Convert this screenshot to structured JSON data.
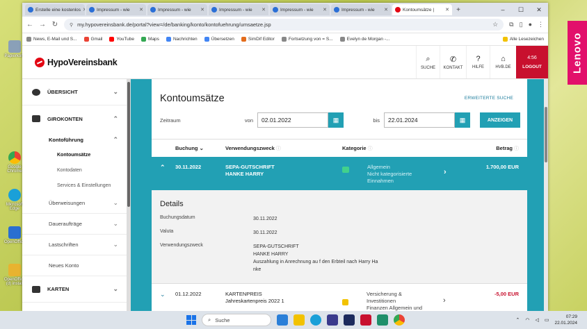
{
  "browser": {
    "tabs": [
      {
        "label": "Erstelle eine kostenlos",
        "active": false
      },
      {
        "label": "Impressum - wie",
        "active": false
      },
      {
        "label": "Impressum - wie",
        "active": false
      },
      {
        "label": "Impressum - wie",
        "active": false
      },
      {
        "label": "Impressum - wie",
        "active": false
      },
      {
        "label": "Impressum - wie",
        "active": false
      },
      {
        "label": "Kontoumsätze |",
        "active": true
      }
    ],
    "url": "my.hypovereinsbank.de/portal?view=/de/banking/konto/kontofuehrung/umsaetze.jsp",
    "bookmarks": [
      "News, E-Mail und S...",
      "Gmail",
      "YouTube",
      "Maps",
      "Nachrichten",
      "Übersetzen",
      "SimDif Editor",
      "Fortsetzung von = S...",
      "Evelyn de Morgan -..."
    ],
    "bookmarks_right": "Alle Lesezeichen"
  },
  "header": {
    "logo": "HypoVereinsbank",
    "actions": [
      {
        "label": "SUCHE",
        "icon": "search-icon",
        "glyph": "⌕"
      },
      {
        "label": "KONTAKT",
        "icon": "phone-icon",
        "glyph": "✆"
      },
      {
        "label": "HILFE",
        "icon": "help-icon",
        "glyph": "?"
      },
      {
        "label": "HVB.DE",
        "icon": "home-icon",
        "glyph": "⌂"
      }
    ],
    "timer": "4:56",
    "logout": "LOGOUT"
  },
  "sidebar": {
    "overview": "ÜBERSICHT",
    "giro": "GIROKONTEN",
    "kontofuehrung": "Kontoführung",
    "sub": [
      "Kontoumsätze",
      "Kontodaten",
      "Services & Einstellungen"
    ],
    "items": [
      "Überweisungen",
      "Daueraufträge",
      "Lastschriften",
      "Neues Konto"
    ],
    "cards": "KARTEN"
  },
  "main": {
    "title": "Kontoumsätze",
    "advanced": "ERWEITERTE SUCHE",
    "period_label": "Zeitraum",
    "from_label": "von",
    "from_value": "02.01.2022",
    "to_label": "bis",
    "to_value": "22.01.2024",
    "show_button": "ANZEIGEN",
    "columns": {
      "date": "Buchung",
      "purpose": "Verwendungszweck",
      "category": "Kategorie",
      "amount": "Betrag"
    },
    "rows": [
      {
        "date": "30.11.2022",
        "purpose_1": "SEPA-GUTSCHRIFT",
        "purpose_2": "HANKE HARRY",
        "category_1": "Allgemein",
        "category_2": "Nicht kategorisierte",
        "category_3": "Einnahmen",
        "amount": "1.700,00 EUR"
      },
      {
        "date": "01.12.2022",
        "purpose_1": "KARTENPREIS",
        "purpose_2": "Jahreskartenpreis 2022 1",
        "category_1": "Versicherung &",
        "category_2": "Investitionen",
        "category_3": "Finanzen Allgemein und",
        "amount": "-5,00 EUR"
      }
    ],
    "details": {
      "heading": "Details",
      "booking_label": "Buchungsdatum",
      "booking_value": "30.11.2022",
      "valuta_label": "Valuta",
      "valuta_value": "30.11.2022",
      "purpose_label": "Verwendungszweck",
      "purpose_lines": [
        "SEPA-GUTSCHRIFT",
        "HANKE HARRY",
        "Auszahlung in Anrechnung au f den Erbteil nach Harry Ha",
        "nke"
      ]
    }
  },
  "taskbar": {
    "search": "Suche",
    "time": "07:29",
    "date": "22.01.2024"
  },
  "desktop": {
    "icons": [
      "Papierkorb",
      "Google Chrome",
      "Microsoft Edge",
      "OpenOffice",
      "OpenOffice (d) install"
    ],
    "brand": "Lenovo"
  }
}
